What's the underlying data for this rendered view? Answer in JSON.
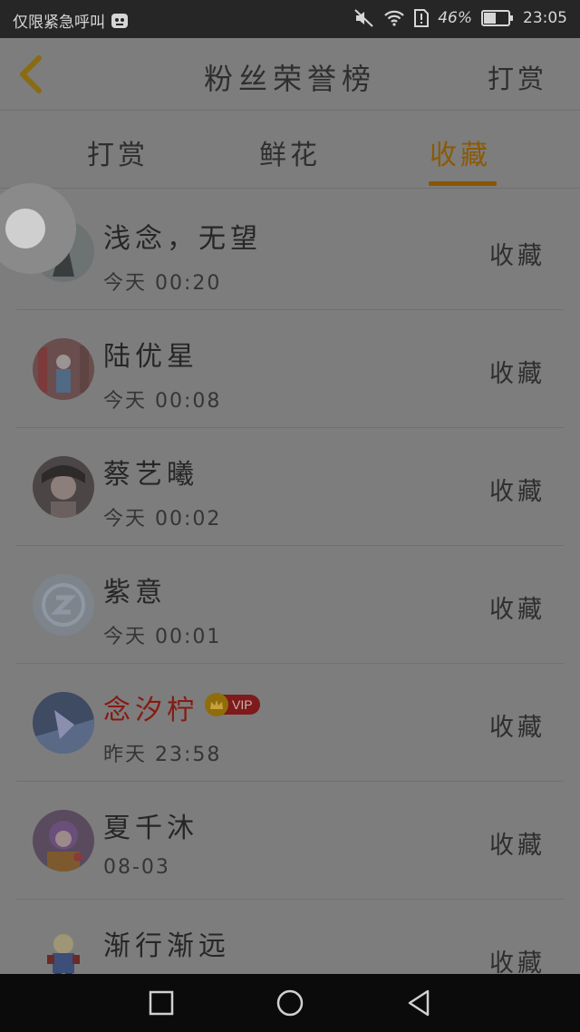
{
  "status_bar": {
    "carrier_text": "仅限紧急呼叫",
    "battery_percent": "46%",
    "time": "23:05",
    "icons": [
      "app-notification-icon",
      "mute-icon",
      "wifi-icon",
      "sim-alert-icon",
      "battery-icon"
    ]
  },
  "header": {
    "back_icon": "back-chevron-icon",
    "title": "粉丝荣誉榜",
    "reward_link": "打赏"
  },
  "tabs": [
    {
      "label": "打赏",
      "active": false
    },
    {
      "label": "鲜花",
      "active": false
    },
    {
      "label": "收藏",
      "active": true
    }
  ],
  "colors": {
    "active_tab": "#8a5a06",
    "vip_name": "#861a12",
    "status_bar": "#262626",
    "nav_bar": "#0b0b0b"
  },
  "list": [
    {
      "name": "浅念，无望",
      "time": "今天 00:20",
      "action": "收藏",
      "vip": false
    },
    {
      "name": "陆优星",
      "time": "今天 00:08",
      "action": "收藏",
      "vip": false
    },
    {
      "name": "蔡艺曦",
      "time": "今天 00:02",
      "action": "收藏",
      "vip": false
    },
    {
      "name": "紫意",
      "time": "今天 00:01",
      "action": "收藏",
      "vip": false
    },
    {
      "name": "念汐柠",
      "time": "昨天 23:58",
      "action": "收藏",
      "vip": true,
      "badge": "VIP"
    },
    {
      "name": "夏千沐",
      "time": "08-03",
      "action": "收藏",
      "vip": false
    },
    {
      "name": "渐行渐远",
      "time": "",
      "action": "收藏",
      "vip": false
    }
  ],
  "nav_bar": {
    "icons": [
      "recent-apps-icon",
      "home-icon",
      "back-triangle-icon"
    ]
  }
}
